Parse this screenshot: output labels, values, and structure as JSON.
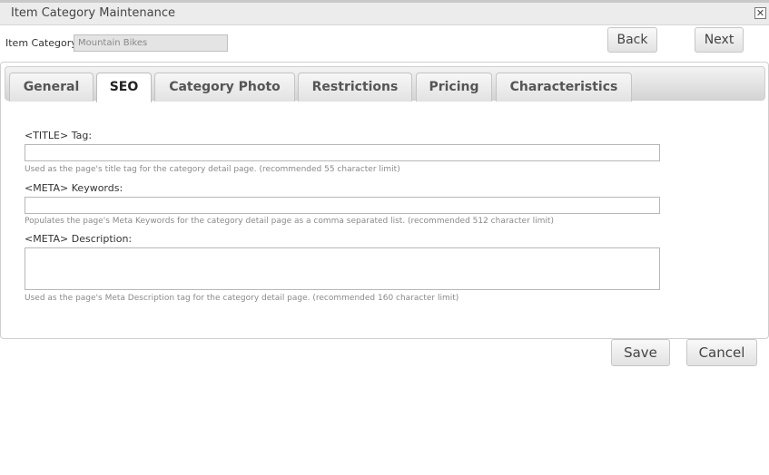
{
  "window": {
    "title": "Item Category Maintenance",
    "close_icon": "close-icon",
    "close_glyph": "✕"
  },
  "header": {
    "category_label": "Item Category:",
    "category_value": "Mountain Bikes",
    "back_label": "Back",
    "next_label": "Next"
  },
  "tabs": [
    {
      "label": "General",
      "active": false
    },
    {
      "label": "SEO",
      "active": true
    },
    {
      "label": "Category Photo",
      "active": false
    },
    {
      "label": "Restrictions",
      "active": false
    },
    {
      "label": "Pricing",
      "active": false
    },
    {
      "label": "Characteristics",
      "active": false
    }
  ],
  "seo": {
    "title_tag": {
      "label": "<TITLE> Tag:",
      "value": "",
      "help": "Used as the page's title tag for the category detail page. (recommended 55 character limit)"
    },
    "meta_keywords": {
      "label": "<META> Keywords:",
      "value": "",
      "help": "Populates the page's Meta Keywords for the category detail page as a comma separated list. (recommended 512 character limit)"
    },
    "meta_description": {
      "label": "<META> Description:",
      "value": "",
      "help": "Used as the page's Meta Description tag for the category detail page. (recommended 160 character limit)"
    }
  },
  "footer": {
    "save_label": "Save",
    "cancel_label": "Cancel"
  }
}
